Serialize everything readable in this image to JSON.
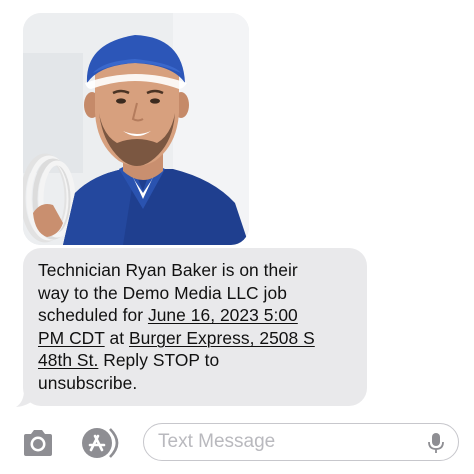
{
  "thread": {
    "message": {
      "line_1": "Technician Ryan Baker is on their",
      "line_2": "way to the Demo Media LLC job",
      "line_3a": "scheduled for ",
      "line_3_link": "June 16, 2023 5:00",
      "line_4_link": "PM CDT",
      "line_4b": " at ",
      "line_4_link2": "Burger Express, 2508 S",
      "line_5_link": "48th St.",
      "line_5b": " Reply STOP to",
      "line_6": "unsubscribe."
    },
    "photo": {
      "icon": "technician-photo"
    }
  },
  "input_bar": {
    "camera_icon": "camera-icon",
    "apps_icon": "app-store-icon",
    "placeholder": "Text Message",
    "mic_icon": "microphone-icon"
  },
  "colors": {
    "bubble_bg": "#e9e9eb",
    "text": "#111111",
    "icon_gray": "#8e8e93",
    "field_border": "#c7c7cc",
    "placeholder": "#b9b9be",
    "uniform_blue": "#1f3f8f"
  }
}
